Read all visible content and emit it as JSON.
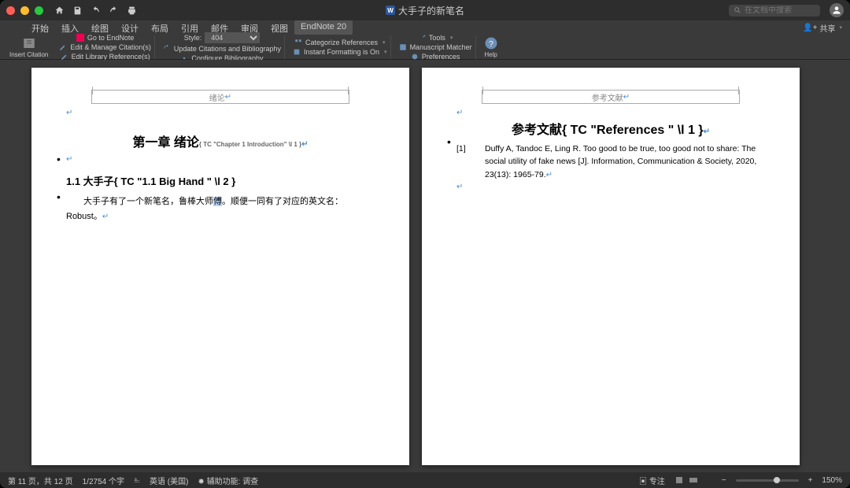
{
  "titlebar": {
    "document_title": "大手子的新笔名",
    "search_placeholder": "在文档中搜索"
  },
  "tabs": {
    "items": [
      "开始",
      "插入",
      "绘图",
      "设计",
      "布局",
      "引用",
      "邮件",
      "审阅",
      "视图",
      "EndNote 20"
    ],
    "active_index": 9,
    "share_label": "共享"
  },
  "ribbon": {
    "insert_citation": "Insert Citation",
    "go_to_endnote": "Go to EndNote",
    "edit_manage": "Edit & Manage Citation(s)",
    "edit_library_ref": "Edit Library Reference(s)",
    "style_label": "Style:",
    "style_value": "404",
    "update_cit": "Update Citations and Bibliography",
    "config_bib": "Configure Bibliography",
    "cat_ref": "Categorize References",
    "instant_fmt": "Instant Formatting is On",
    "tools": "Tools",
    "manuscript": "Manuscript Matcher",
    "preferences": "Preferences",
    "help": "Help"
  },
  "page_left": {
    "header_label": "绪论",
    "h1": "第一章  绪论",
    "h1_code": "{ TC   \"Chapter 1 Introduction\" \\l 1 }",
    "h2": "1.1 大手子{  TC    \"1.1 Big Hand \" \\l 2  }",
    "body_a": "大手子有了一个新笔名，鲁棒大师",
    "body_hl": "傅",
    "body_b": "。顺便一同有了对应的英文名：Robust。"
  },
  "page_right": {
    "header_label": "参考文献",
    "h1": "参考文献{  TC    \"References \" \\l 1  }",
    "ref_num": "[1]",
    "ref_text": "Duffy A, Tandoc E, Ling R. Too good to be true, too good not to share: The social utility of fake news [J]. Information, Communication & Society, 2020, 23(13): 1965-79."
  },
  "status": {
    "pages": "第 11 页，共 12 页",
    "words": "1/2754 个字",
    "lang_icon": "⎁",
    "lang": "英语 (美国)",
    "a11y": "辅助功能: 调查",
    "focus": "专注",
    "zoom": "150%"
  }
}
